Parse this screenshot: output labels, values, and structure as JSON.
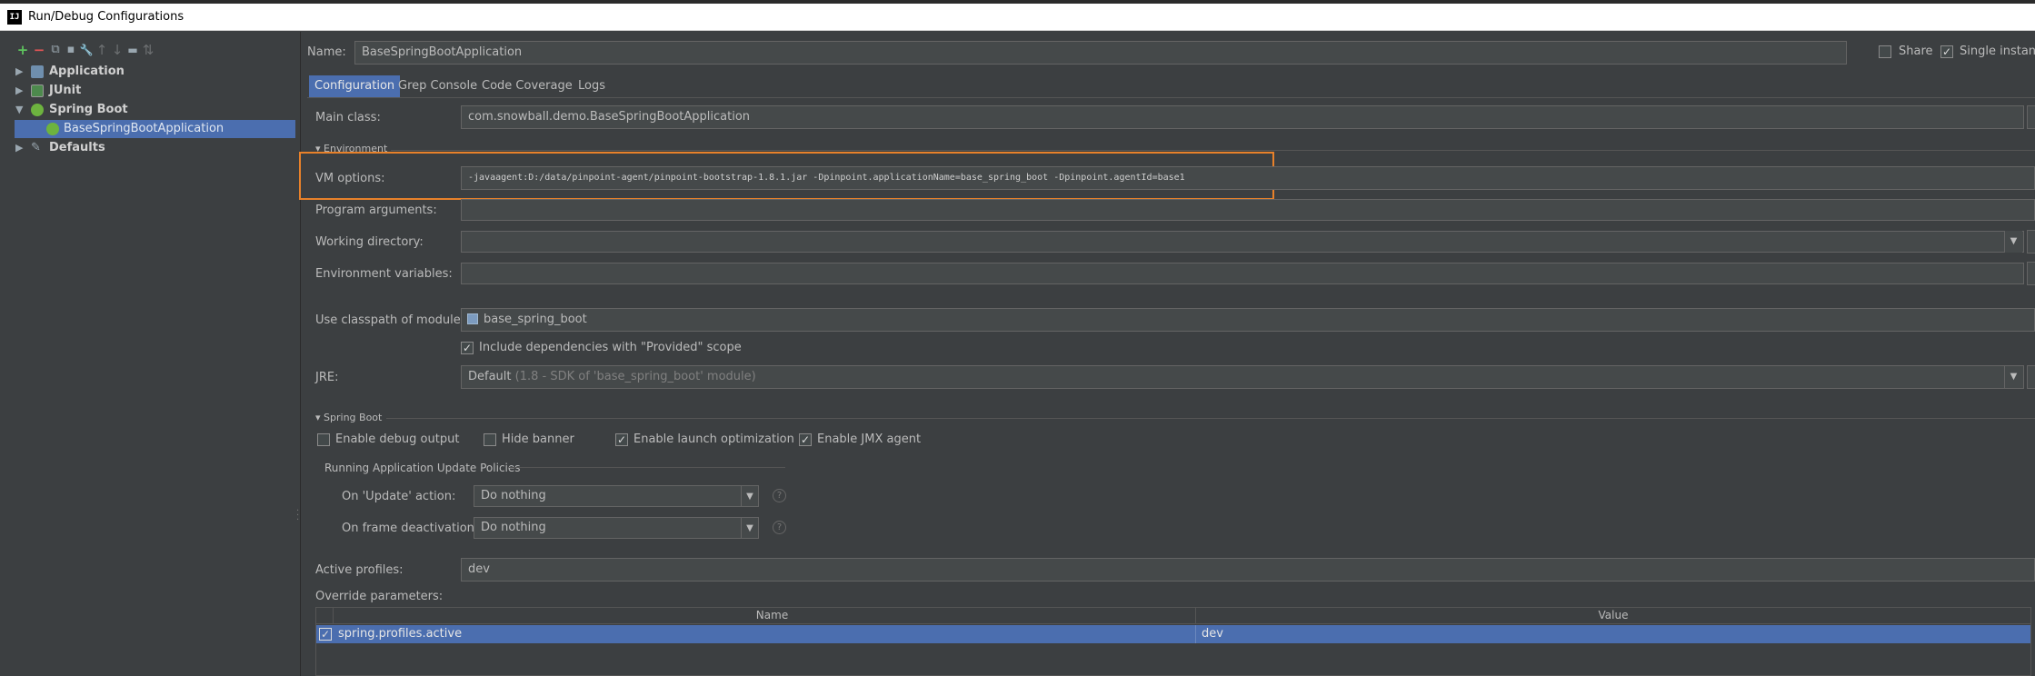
{
  "window": {
    "title": "Run/Debug Configurations",
    "logo_text": "IJ"
  },
  "sidebar": {
    "toolbar_icons": [
      "add-icon",
      "remove-icon",
      "copy-icon",
      "save-icon",
      "edit-templates-icon",
      "move-up-icon",
      "move-down-icon",
      "folder-icon",
      "sort-icon"
    ],
    "toolbar_glyphs": [
      "+",
      "−",
      "⧉",
      "▪",
      "🔧",
      "↑",
      "↓",
      "▬",
      "⇅"
    ],
    "tree": [
      {
        "label": "Application",
        "arrow": "▶"
      },
      {
        "label": "JUnit",
        "arrow": "▶"
      },
      {
        "label": "Spring Boot",
        "arrow": "▼"
      },
      {
        "label": "BaseSpringBootApplication"
      },
      {
        "label": "Defaults",
        "arrow": "▶"
      }
    ]
  },
  "header": {
    "name_label": "Name:",
    "name_value": "BaseSpringBootApplication",
    "share_label": "Share",
    "share_checked": false,
    "single_instance_label": "Single instance",
    "single_instance_checked": true
  },
  "tabs": [
    "Configuration",
    "Grep Console",
    "Code Coverage",
    "Logs"
  ],
  "form": {
    "main_class_label": "Main class:",
    "main_class_value": "com.snowball.demo.BaseSpringBootApplication",
    "environment_section": "Environment",
    "vm_options_label": "VM options:",
    "vm_options_value": "-javaagent:D:/data/pinpoint-agent/pinpoint-bootstrap-1.8.1.jar -Dpinpoint.applicationName=base_spring_boot -Dpinpoint.agentId=base1",
    "program_arguments_label": "Program arguments:",
    "working_directory_label": "Working directory:",
    "environment_variables_label": "Environment variables:",
    "classpath_label": "Use classpath of module:",
    "classpath_value": "base_spring_boot",
    "include_deps_label": "Include dependencies with \"Provided\" scope",
    "include_deps_checked": true,
    "jre_label": "JRE:",
    "jre_value": "Default",
    "jre_hint": "(1.8 - SDK of 'base_spring_boot' module)"
  },
  "spring_boot": {
    "section_title": "Spring Boot",
    "enable_debug_label": "Enable debug output",
    "enable_debug_checked": false,
    "hide_banner_label": "Hide banner",
    "hide_banner_checked": false,
    "launch_opt_label": "Enable launch optimization",
    "launch_opt_checked": true,
    "jmx_label": "Enable JMX agent",
    "jmx_checked": true,
    "update_policies_title": "Running Application Update Policies",
    "on_update_label": "On 'Update' action:",
    "on_update_value": "Do nothing",
    "on_frame_label": "On frame deactivation:",
    "on_frame_value": "Do nothing",
    "help_glyph": "?",
    "active_profiles_label": "Active profiles:",
    "active_profiles_value": "dev",
    "override_params_label": "Override parameters:",
    "table_headers": [
      "Name",
      "Value"
    ],
    "table_rows": [
      {
        "checked": true,
        "name": "spring.profiles.active",
        "value": "dev"
      }
    ]
  },
  "colors": {
    "background": "#3c3f41",
    "selection": "#4b6eaf",
    "highlight_box": "#e8812a",
    "tab_active": "#4b6eaf"
  },
  "glyphs": {
    "check": "✓",
    "dropdown": "▼"
  }
}
